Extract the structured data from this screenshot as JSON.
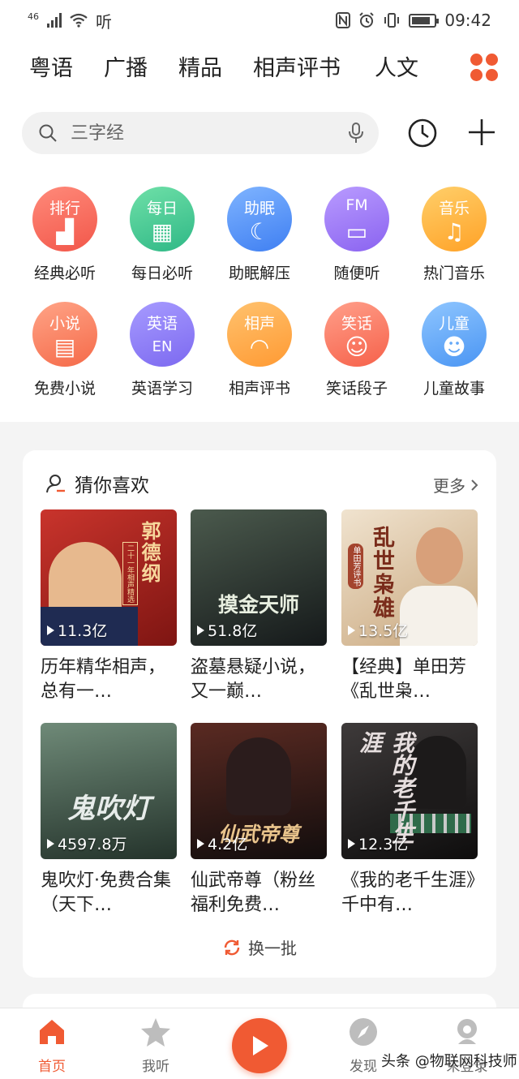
{
  "status_bar": {
    "network": "46",
    "speed": "听",
    "time": "09:42"
  },
  "categories": [
    "粤语",
    "广播",
    "精品",
    "相声评书",
    "人文"
  ],
  "search": {
    "placeholder": "三字经"
  },
  "quick_entries": [
    {
      "badge": "排行",
      "label": "经典必听",
      "color_a": "#ff8a7a",
      "color_b": "#f2574a"
    },
    {
      "badge": "每日",
      "label": "每日必听",
      "color_a": "#6fe0a8",
      "color_b": "#2fb886"
    },
    {
      "badge": "助眠",
      "label": "助眠解压",
      "color_a": "#7fb4ff",
      "color_b": "#3f7ff2"
    },
    {
      "badge": "FM",
      "label": "随便听",
      "color_a": "#b99bff",
      "color_b": "#8a63f0"
    },
    {
      "badge": "音乐",
      "label": "热门音乐",
      "color_a": "#ffcf6a",
      "color_b": "#ffa227"
    },
    {
      "badge": "小说",
      "label": "免费小说",
      "color_a": "#ffa487",
      "color_b": "#f56a49"
    },
    {
      "badge": "英语",
      "label": "英语学习",
      "color_a": "#a79bff",
      "color_b": "#7c69f0"
    },
    {
      "badge": "相声",
      "label": "相声评书",
      "color_a": "#ffc26e",
      "color_b": "#ff9a33"
    },
    {
      "badge": "笑话",
      "label": "笑话段子",
      "color_a": "#ff9f8a",
      "color_b": "#f6614a"
    },
    {
      "badge": "儿童",
      "label": "儿童故事",
      "color_a": "#8fc6ff",
      "color_b": "#4a95f3"
    }
  ],
  "recommend": {
    "heading": "猜你喜欢",
    "more": "更多",
    "refresh": "换一批",
    "albums": [
      {
        "cover_text": "郭德纲",
        "cover_sub": "二十一年相声精选",
        "plays": "11.3亿",
        "title": "历年精华相声，总有一…",
        "bg_a": "#c9342c",
        "bg_b": "#7e1512"
      },
      {
        "cover_text": "摸金天师",
        "cover_sub": "",
        "plays": "51.8亿",
        "title": "盗墓悬疑小说，又一巅…",
        "bg_a": "#4b5a4d",
        "bg_b": "#15191a"
      },
      {
        "cover_text": "乱世枭雄",
        "cover_sub": "单田芳评书",
        "plays": "13.5亿",
        "title": "【经典】单田芳《乱世枭…",
        "bg_a": "#f0e3cf",
        "bg_b": "#c8a67c"
      },
      {
        "cover_text": "鬼吹灯",
        "cover_sub": "",
        "plays": "4597.8万",
        "title": "鬼吹灯·免费合集（天下…",
        "bg_a": "#6f8a78",
        "bg_b": "#24332b"
      },
      {
        "cover_text": "仙武帝尊",
        "cover_sub": "",
        "plays": "4.2亿",
        "title": "仙武帝尊（粉丝福利免费…",
        "bg_a": "#5a2a22",
        "bg_b": "#120d0d"
      },
      {
        "cover_text": "我的老千生涯",
        "cover_sub": "",
        "plays": "12.3亿",
        "title": "《我的老千生涯》千中有…",
        "bg_a": "#3e3a3a",
        "bg_b": "#0e0d0d"
      }
    ]
  },
  "bottom_nav": [
    "首页",
    "我听",
    "发现",
    "未登录"
  ],
  "watermark": "头条 @物联网科技师"
}
